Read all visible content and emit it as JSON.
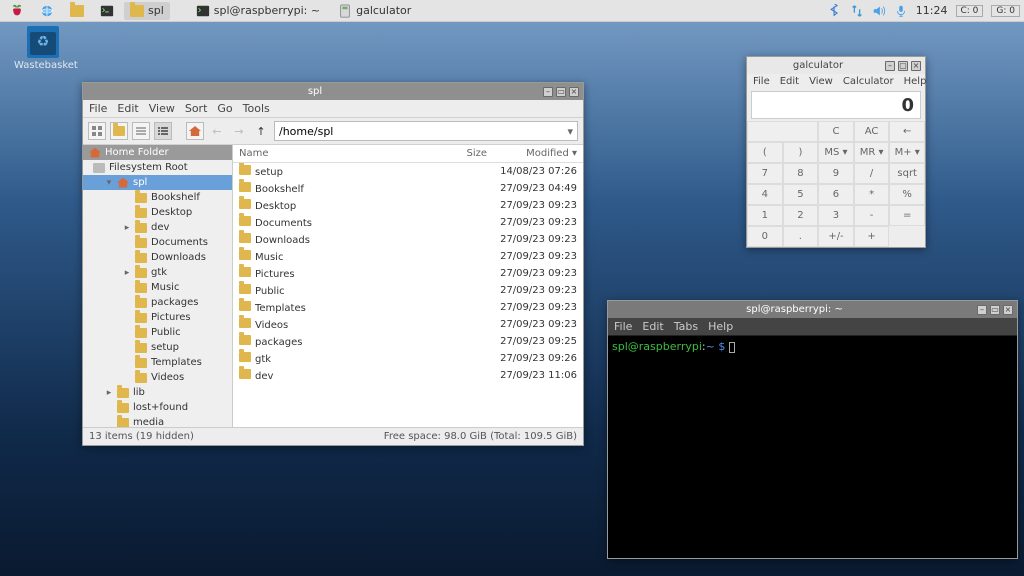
{
  "taskbar": {
    "app_folder_label": "spl",
    "tasks": [
      {
        "icon": "terminal",
        "label": "spl@raspberrypi: ~"
      },
      {
        "icon": "calc",
        "label": "galculator"
      }
    ],
    "clock": "11:24",
    "tray_c": "C: 0",
    "tray_g": "G: 0"
  },
  "desktop": {
    "wastebasket": "Wastebasket"
  },
  "fm": {
    "title": "spl",
    "menus": [
      "File",
      "Edit",
      "View",
      "Sort",
      "Go",
      "Tools"
    ],
    "path": "/home/spl",
    "sidebar": {
      "home": "Home Folder",
      "fsroot": "Filesystem Root",
      "spl": "spl",
      "lib": "lib",
      "lostfound": "lost+found",
      "media": "media",
      "children": [
        "Bookshelf",
        "Desktop",
        "dev",
        "Documents",
        "Downloads",
        "gtk",
        "Music",
        "packages",
        "Pictures",
        "Public",
        "setup",
        "Templates",
        "Videos"
      ],
      "expandable": {
        "dev": true,
        "gtk": true
      }
    },
    "columns": {
      "name": "Name",
      "size": "Size",
      "modified": "Modified"
    },
    "files": [
      {
        "name": "setup",
        "modified": "14/08/23 07:26"
      },
      {
        "name": "Bookshelf",
        "modified": "27/09/23 04:49"
      },
      {
        "name": "Desktop",
        "modified": "27/09/23 09:23"
      },
      {
        "name": "Documents",
        "modified": "27/09/23 09:23"
      },
      {
        "name": "Downloads",
        "modified": "27/09/23 09:23"
      },
      {
        "name": "Music",
        "modified": "27/09/23 09:23"
      },
      {
        "name": "Pictures",
        "modified": "27/09/23 09:23"
      },
      {
        "name": "Public",
        "modified": "27/09/23 09:23"
      },
      {
        "name": "Templates",
        "modified": "27/09/23 09:23"
      },
      {
        "name": "Videos",
        "modified": "27/09/23 09:23"
      },
      {
        "name": "packages",
        "modified": "27/09/23 09:25"
      },
      {
        "name": "gtk",
        "modified": "27/09/23 09:26"
      },
      {
        "name": "dev",
        "modified": "27/09/23 11:06"
      }
    ],
    "status_left": "13 items (19 hidden)",
    "status_right": "Free space: 98.0 GiB (Total: 109.5 GiB)"
  },
  "calc": {
    "title": "galculator",
    "menus": [
      "File",
      "Edit",
      "View",
      "Calculator",
      "Help"
    ],
    "display": "0",
    "rows": [
      [
        "",
        "",
        "C",
        "AC",
        "←"
      ],
      [
        "(",
        ")",
        "MS ▾",
        "MR ▾",
        "M+ ▾"
      ],
      [
        "7",
        "8",
        "9",
        "/",
        "sqrt"
      ],
      [
        "4",
        "5",
        "6",
        "*",
        "%"
      ],
      [
        "1",
        "2",
        "3",
        "-",
        "="
      ],
      [
        "0",
        ".",
        "+/-",
        "+"
      ]
    ]
  },
  "term": {
    "title": "spl@raspberrypi: ~",
    "menus": [
      "File",
      "Edit",
      "Tabs",
      "Help"
    ],
    "prompt_host": "spl@raspberrypi",
    "prompt_colon": ":",
    "prompt_path": "~",
    "prompt_dollar": " $ "
  }
}
